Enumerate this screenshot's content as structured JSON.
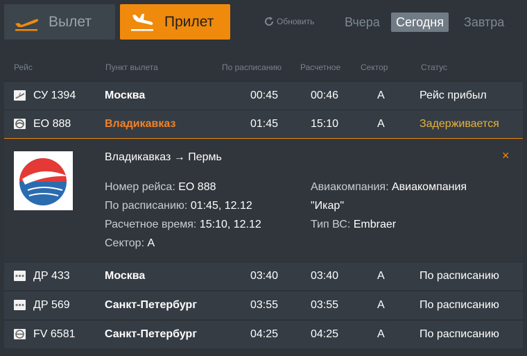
{
  "tabs": {
    "departure": "Вылет",
    "arrival": "Прилет"
  },
  "refresh_label": "Обновить",
  "days": {
    "yesterday": "Вчера",
    "today": "Сегодня",
    "tomorrow": "Завтра"
  },
  "columns": {
    "flight": "Рейс",
    "origin": "Пункт вылета",
    "scheduled": "По расписанию",
    "estimated": "Расчетное",
    "sector": "Сектор",
    "status": "Статус"
  },
  "flights": [
    {
      "flight": "СУ 1394",
      "city": "Москва",
      "scheduled": "00:45",
      "estimated": "00:46",
      "sector": "A",
      "status": "Рейс прибыл"
    },
    {
      "flight": "ЕО 888",
      "city": "Владикавказ",
      "scheduled": "01:45",
      "estimated": "15:10",
      "sector": "A",
      "status": "Задерживается"
    },
    {
      "flight": "ДР 433",
      "city": "Москва",
      "scheduled": "03:40",
      "estimated": "03:40",
      "sector": "A",
      "status": "По расписанию"
    },
    {
      "flight": "ДР 569",
      "city": "Санкт-Петербург",
      "scheduled": "03:55",
      "estimated": "03:55",
      "sector": "A",
      "status": "По расписанию"
    },
    {
      "flight": "FV 6581",
      "city": "Санкт-Петербург",
      "scheduled": "04:25",
      "estimated": "04:25",
      "sector": "A",
      "status": "По расписанию"
    }
  ],
  "details": {
    "route": "Владикавказ → Пермь",
    "flight_number_label": "Номер рейса:",
    "flight_number": "ЕО 888",
    "scheduled_label": "По расписанию:",
    "scheduled": "01:45, 12.12",
    "estimated_label": "Расчетное время:",
    "estimated": "15:10, 12.12",
    "sector_label": "Сектор:",
    "sector": "A",
    "airline_label": "Авиакомпания:",
    "airline_line1": "Авиакомпания",
    "airline_line2": "\"Икар\"",
    "aircraft_label": "Тип ВС:",
    "aircraft": "Embraer",
    "close": "×"
  },
  "colors": {
    "accent": "#f08a0c",
    "delayed": "#e8b33a",
    "background": "#2e343a"
  }
}
